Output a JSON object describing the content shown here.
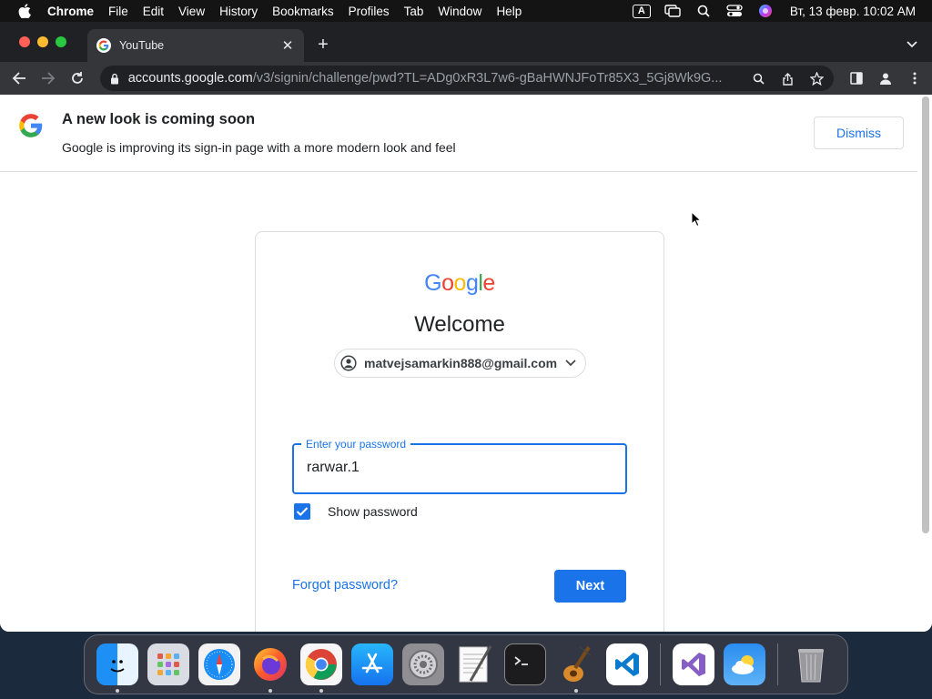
{
  "menubar": {
    "app_name": "Chrome",
    "items": [
      "File",
      "Edit",
      "View",
      "History",
      "Bookmarks",
      "Profiles",
      "Tab",
      "Window",
      "Help"
    ],
    "input_indicator": "A",
    "clock": "Вт, 13 февр.  10:02 AM"
  },
  "browser": {
    "tab_title": "YouTube",
    "url_host": "accounts.google.com",
    "url_path": "/v3/signin/challenge/pwd?TL=ADg0xR3L7w6-gBaHWNJFoTr85X3_5Gj8Wk9G..."
  },
  "banner": {
    "title": "A new look is coming soon",
    "subtitle": "Google is improving its sign-in page with a more modern look and feel",
    "dismiss_label": "Dismiss"
  },
  "signin": {
    "wordmark": [
      "G",
      "o",
      "o",
      "g",
      "l",
      "e"
    ],
    "wordmark_colors": [
      "#4285F4",
      "#EA4335",
      "#FBBC05",
      "#4285F4",
      "#34A853",
      "#EA4335"
    ],
    "heading": "Welcome",
    "account_email": "matvejsamarkin888@gmail.com",
    "password_label": "Enter your password",
    "password_value": "rarwar.1",
    "show_password_label": "Show password",
    "show_password_checked": true,
    "forgot_label": "Forgot password?",
    "next_label": "Next"
  },
  "colors": {
    "accent": "#1a73e8",
    "text": "#202124",
    "border": "#dadce0"
  },
  "dock": {
    "apps": [
      "finder-icon",
      "launchpad-icon",
      "safari-icon",
      "firefox-icon",
      "chrome-icon",
      "app-store-icon",
      "system-settings-icon",
      "textedit-icon",
      "terminal-icon",
      "instruments-icon",
      "vscode-icon",
      "visual-studio-icon",
      "weather-icon",
      "trash-icon"
    ]
  }
}
